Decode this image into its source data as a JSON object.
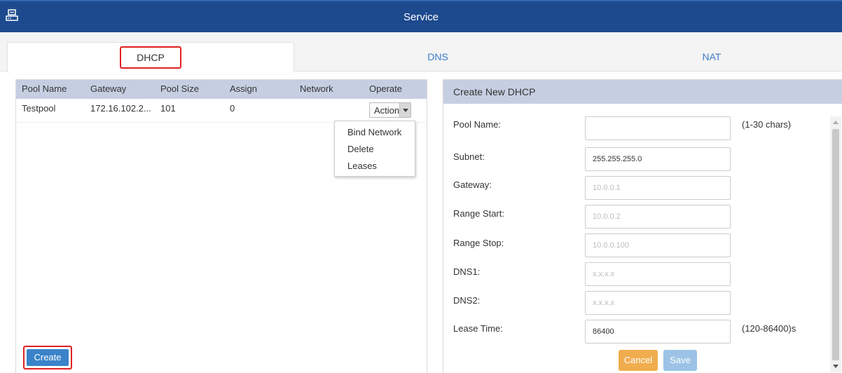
{
  "window": {
    "title": "Service"
  },
  "tabs": [
    {
      "label": "DHCP",
      "active": true
    },
    {
      "label": "DNS",
      "active": false
    },
    {
      "label": "NAT",
      "active": false
    }
  ],
  "table": {
    "headers": [
      "Pool Name",
      "Gateway",
      "Pool Size",
      "Assign",
      "Network",
      "Operate"
    ],
    "rows": [
      {
        "pool_name": "Testpool",
        "gateway": "172.16.102.2...",
        "pool_size": "101",
        "assign": "0",
        "network": "",
        "operate": "Action"
      }
    ]
  },
  "action_menu": {
    "items": [
      "Bind Network",
      "Delete",
      "Leases"
    ]
  },
  "create_button": "Create",
  "form": {
    "title": "Create New DHCP",
    "fields": [
      {
        "label": "Pool Name:",
        "value": "",
        "placeholder": "",
        "hint": "(1-30 chars)"
      },
      {
        "label": "Subnet:",
        "value": "255.255.255.0",
        "placeholder": "",
        "hint": ""
      },
      {
        "label": "Gateway:",
        "value": "",
        "placeholder": "10.0.0.1",
        "hint": ""
      },
      {
        "label": "Range Start:",
        "value": "",
        "placeholder": "10.0.0.2",
        "hint": ""
      },
      {
        "label": "Range Stop:",
        "value": "",
        "placeholder": "10.0.0.100",
        "hint": ""
      },
      {
        "label": "DNS1:",
        "value": "",
        "placeholder": "x.x.x.x",
        "hint": ""
      },
      {
        "label": "DNS2:",
        "value": "",
        "placeholder": "x.x.x.x",
        "hint": ""
      },
      {
        "label": "Lease Time:",
        "value": "86400",
        "placeholder": "",
        "hint": "(120-86400)s"
      }
    ],
    "cancel_label": "Cancel",
    "save_label": "Save"
  },
  "colors": {
    "titlebar": "#1d4a8f",
    "table_header": "#c6cfe2",
    "primary_button": "#3a83c9",
    "cancel_button": "#f0ad4e",
    "save_button": "#9cc3e6",
    "highlight": "#e02020",
    "tab_text": "#3a7bc8"
  }
}
